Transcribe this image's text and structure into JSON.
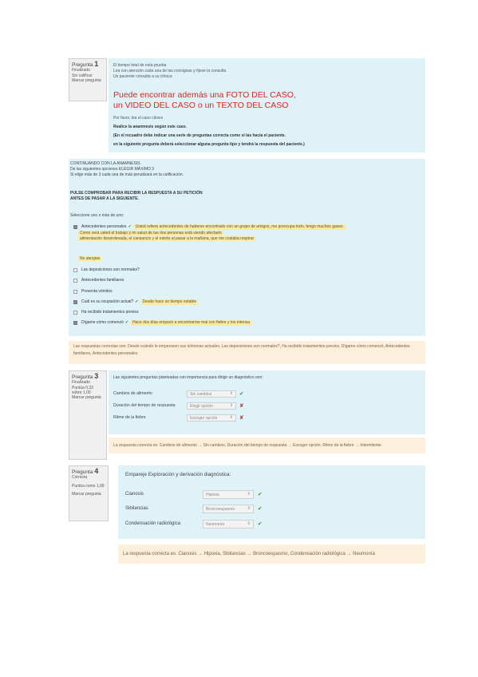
{
  "q1": {
    "info": {
      "question": "Pregunta",
      "number": "1",
      "state": "Finalizado",
      "points": "Sin calificar",
      "flag": "Marcar pregunta"
    },
    "intro_lines": [
      "El tiempo total de esta prueba",
      "Lea con atención cada una de las consignas y fíjese la consulta",
      "Un paciente consulta a su clínica:"
    ],
    "highlight_lines": [
      "Puede encontrar además una FOTO DEL CASO,",
      "un VIDEO DEL CASO o un TEXTO DEL CASO"
    ],
    "small_line": "Por favor, lea el caso clínico",
    "bold_lines": [
      "Realice la anamnesis según este caso.",
      "(En el recuadro debe indicar una serie de preguntas correcta como si las hacía el paciente.",
      "en la siguiente pregunta deberá seleccionar alguna pregunta tipo y tendrá la respuesta del paciente.)"
    ]
  },
  "q2": {
    "header_lines": [
      "CONTINUANDO CON LA ANAMNESIS.",
      "De las siguientes opciones ELEGIR MÁXIMO 3",
      "Si elige más de 3 cada una de más penalizará en la calificación."
    ],
    "bold_lines": [
      "PULSE COMPROBAR PARA RECIBIR LA RESPUESTA A SU PETICIÓN",
      "ANTES DE PASAR A LA SIGUIENTE."
    ],
    "select_prompt": "Seleccione uno o más de uno:",
    "options": [
      {
        "label": "Antecedentes personales",
        "checked": true,
        "mark": "correct",
        "feedback": "Usted refiere antecedentes de haberse encontrado con un grupo de amigos, me preocupa todo, tengo muchos gases."
      },
      {
        "label": "Las deposiciones son normales?",
        "checked": false,
        "mark": "",
        "feedback": ""
      },
      {
        "label": "Antecedentes familiares",
        "checked": false,
        "mark": "",
        "feedback": ""
      },
      {
        "label": "Presenta vómitos",
        "checked": false,
        "mark": "",
        "feedback": ""
      },
      {
        "label": "Cuál es su ocupación actual?",
        "checked": true,
        "mark": "correct",
        "feedback": "Desde hace un tiempo estable"
      },
      {
        "label": "Ha recibido tratamientos previos",
        "checked": false,
        "mark": "",
        "feedback": ""
      },
      {
        "label": "Dígame cómo comenzó",
        "checked": true,
        "mark": "correct",
        "feedback": "Hace dos días empezó a encontrarme mal con fiebre y tos intensa"
      }
    ],
    "extra_feedback_lines": [
      "Como verá usted el trabajo y mi salud de las dos personas está siendo afectado",
      "alimentación desordenada, el cansancio y el estrés al pasar a la mañana, que me costaba respirar"
    ],
    "sublabel": "No alergias",
    "feedback": "Las respuestas correctas son: Desde cuándo le empezaron sus síntomas actuales, Las deposiciones son normales?, Ha recibido tratamientos previos, Dígame cómo comenzó, Antecedentes familiares, Antecedentes personales"
  },
  "q3": {
    "info": {
      "question": "Pregunta",
      "number": "3",
      "state": "Finalizado",
      "points": "Puntúa 0,33 sobre 1,00",
      "flag": "Marcar pregunta"
    },
    "prompt": "Las siguientes preguntas planteadas con importancia para dirigir un diagnóstico son:",
    "rows": [
      {
        "label": "Cambios de alimento",
        "value": "Sin cambios",
        "mark": "correct"
      },
      {
        "label": "Duración del tiempo de respuesta",
        "value": "Elegir opción",
        "mark": "incorrect"
      },
      {
        "label": "Ritmo de la fiebre",
        "value": "Escoger opción",
        "mark": "incorrect"
      }
    ],
    "feedback": "La respuesta correcta es: Cambios de alimento → Sin cambios, Duración del tiempo de respuesta → Escoger opción, Ritmo de la fiebre → Intermitente"
  },
  "q4": {
    "info": {
      "question": "Pregunta",
      "number": "4",
      "state": "Correcta",
      "points": "Puntúa como 1,00",
      "flag": "Marcar pregunta"
    },
    "prompt": "Empareje Exploración y derivación diagnóstica:",
    "rows": [
      {
        "label": "Cianosis",
        "value": "Hipoxia",
        "mark": "correct"
      },
      {
        "label": "Sibilancias",
        "value": "Broncoespasmo",
        "mark": "correct"
      },
      {
        "label": "Condensación radiológica",
        "value": "Neumonía",
        "mark": "correct"
      }
    ],
    "feedback": "La respuesta correcta es: Cianosis → Hipoxia, Sibilancias → Broncoespasmo, Condensación radiológica → Neumonía"
  },
  "icons": {
    "correct": "✔",
    "incorrect": "✘",
    "dropdown": "⇕"
  },
  "colors": {
    "panel": "#def2f8",
    "feedback": "#fcefdc",
    "highlight": "#e0241a",
    "correct": "#2e8b2e",
    "incorrect": "#c0281e"
  }
}
